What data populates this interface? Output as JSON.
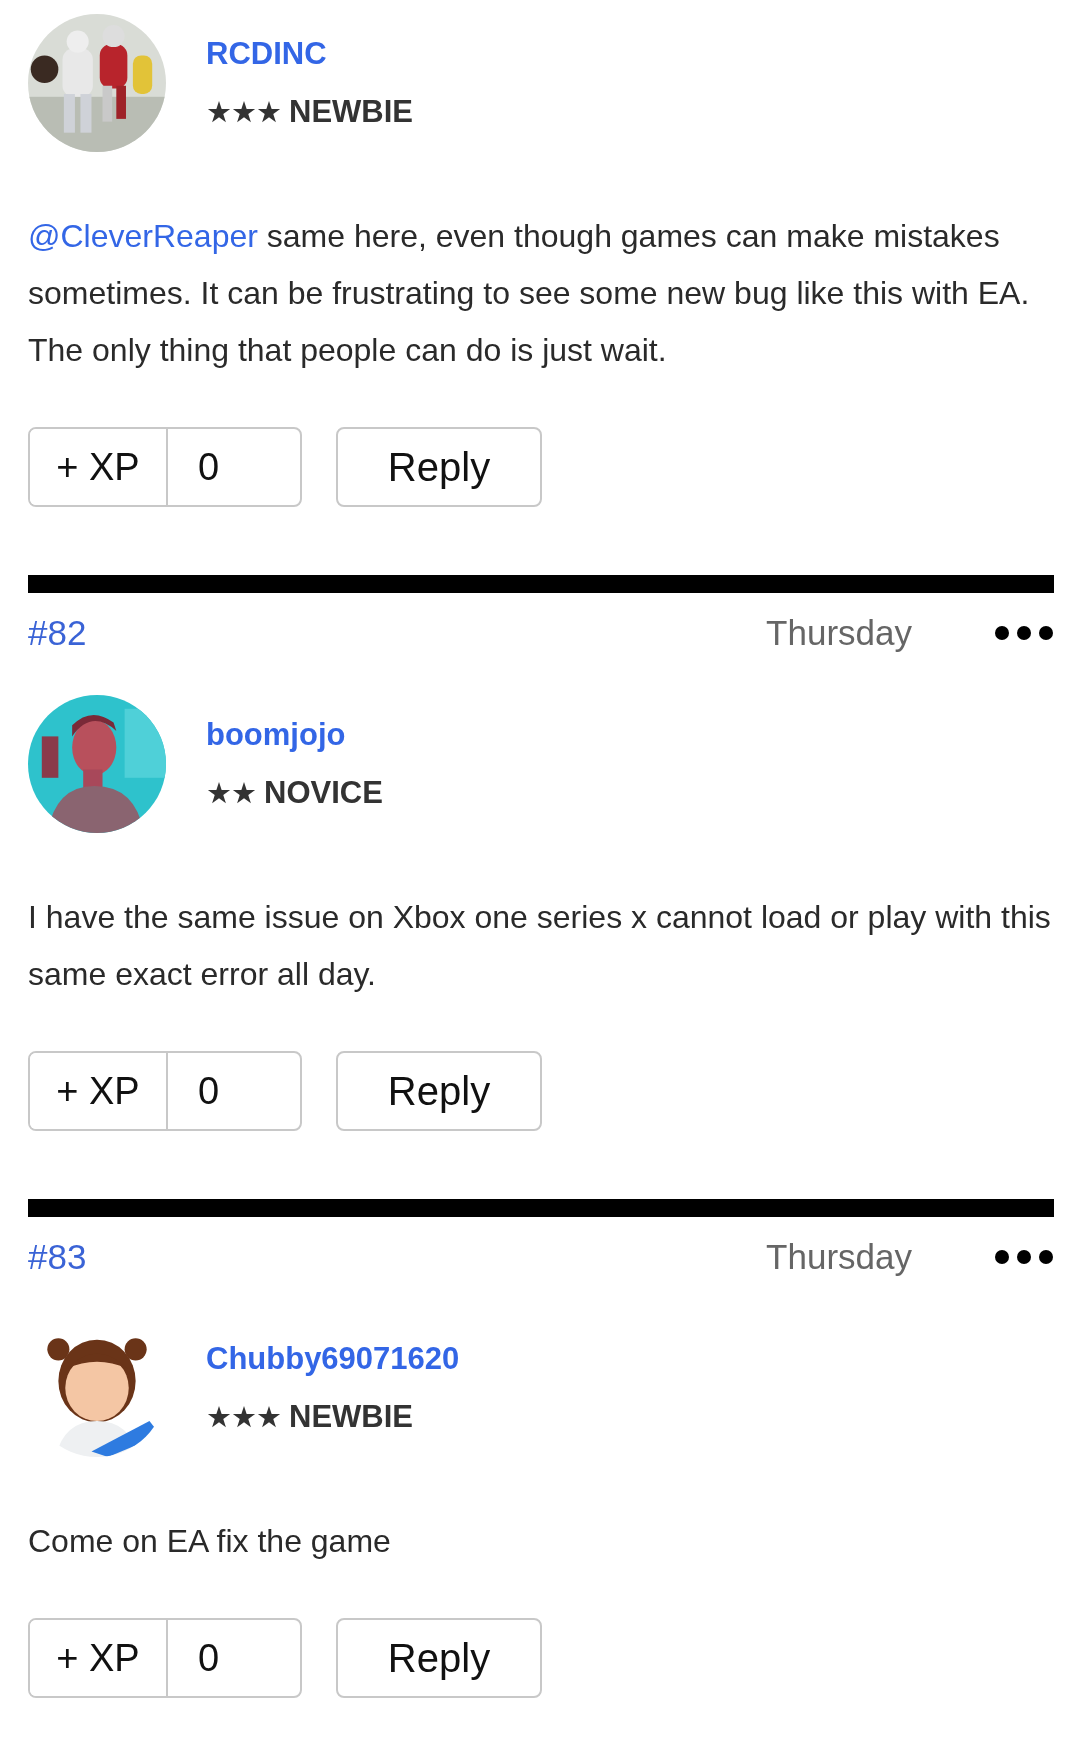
{
  "posts": [
    {
      "author": {
        "name": "RCDINC",
        "rank_stars": "★★★",
        "rank": "NEWBIE"
      },
      "body": {
        "mention": "@CleverReaper",
        "text": " same here, even though games can make mistakes sometimes. It can be frustrating to see some new bug like this with EA. The only thing that people can do is just wait."
      },
      "xp_label": "+ XP",
      "xp_count": "0",
      "reply_label": "Reply"
    },
    {
      "number": "#82",
      "date": "Thursday",
      "author": {
        "name": "boomjojo",
        "rank_stars": "★★",
        "rank": "NOVICE"
      },
      "body": {
        "text": "I have the same issue on Xbox one series x cannot load or play with this same exact error all day."
      },
      "xp_label": "+ XP",
      "xp_count": "0",
      "reply_label": "Reply"
    },
    {
      "number": "#83",
      "date": "Thursday",
      "author": {
        "name": "Chubby69071620",
        "rank_stars": "★★★",
        "rank": "NEWBIE"
      },
      "body": {
        "text": "Come on EA fix the game"
      },
      "xp_label": "+ XP",
      "xp_count": "0",
      "reply_label": "Reply"
    }
  ]
}
